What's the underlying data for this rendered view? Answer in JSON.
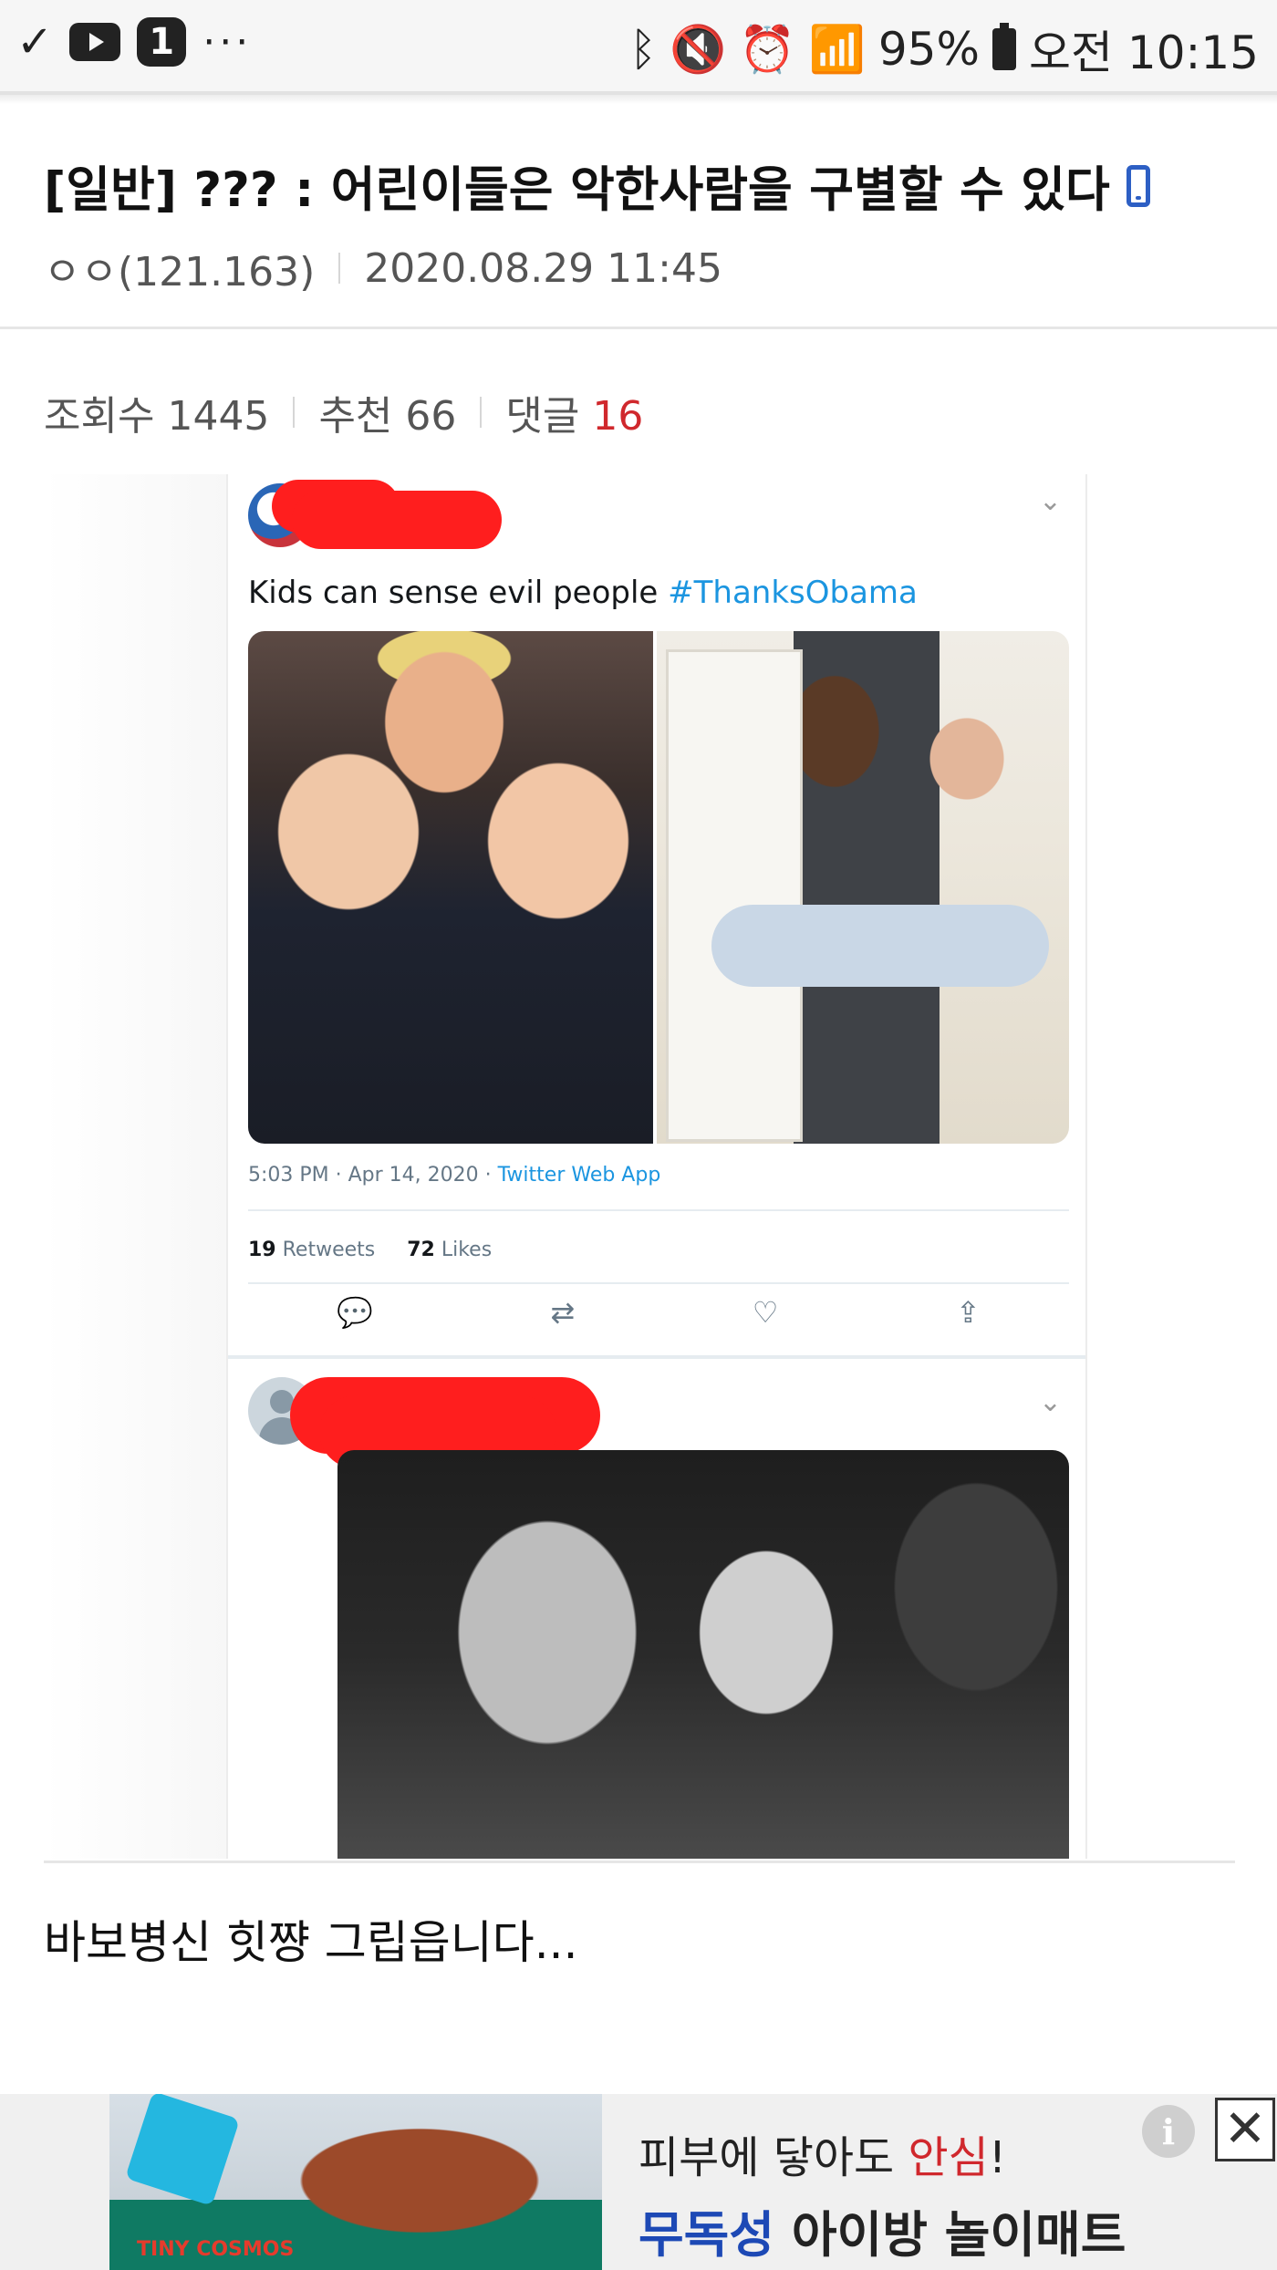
{
  "status_bar": {
    "notification_count": "1",
    "more": "···",
    "battery_percent": "95%",
    "time": "오전 10:15"
  },
  "post": {
    "title": "[일반] ??? : 어린이들은 악한사람을 구별할 수 있다",
    "author": "ㅇㅇ(121.163)",
    "date": "2020.08.29 11:45",
    "views_label": "조회수",
    "views": "1445",
    "recommend_label": "추천",
    "recommend": "66",
    "comments_label": "댓글",
    "comments": "16",
    "body": "바보병신 힛쨩 그립읍니다..."
  },
  "embedded_tweet": {
    "text": "Kids can sense evil people",
    "hashtag": "#ThanksObama",
    "timestamp": "5:03 PM · Apr 14, 2020 · ",
    "source": "Twitter Web App",
    "retweets": "19",
    "retweets_label": "Retweets",
    "likes": "72",
    "likes_label": "Likes",
    "chevron": "⌄"
  },
  "ad": {
    "line1_prefix": "피부에 닿아도 ",
    "line1_highlight": "안심",
    "line1_suffix": "!",
    "line2_highlight": "무독성",
    "line2_rest": " 아이방 놀이매트",
    "brand": "TINY COSMOS",
    "info": "i",
    "close": "✕"
  },
  "colors": {
    "accent_red": "#d0282d",
    "twitter_blue": "#1b95e0",
    "ad_blue": "#1d49b5"
  }
}
